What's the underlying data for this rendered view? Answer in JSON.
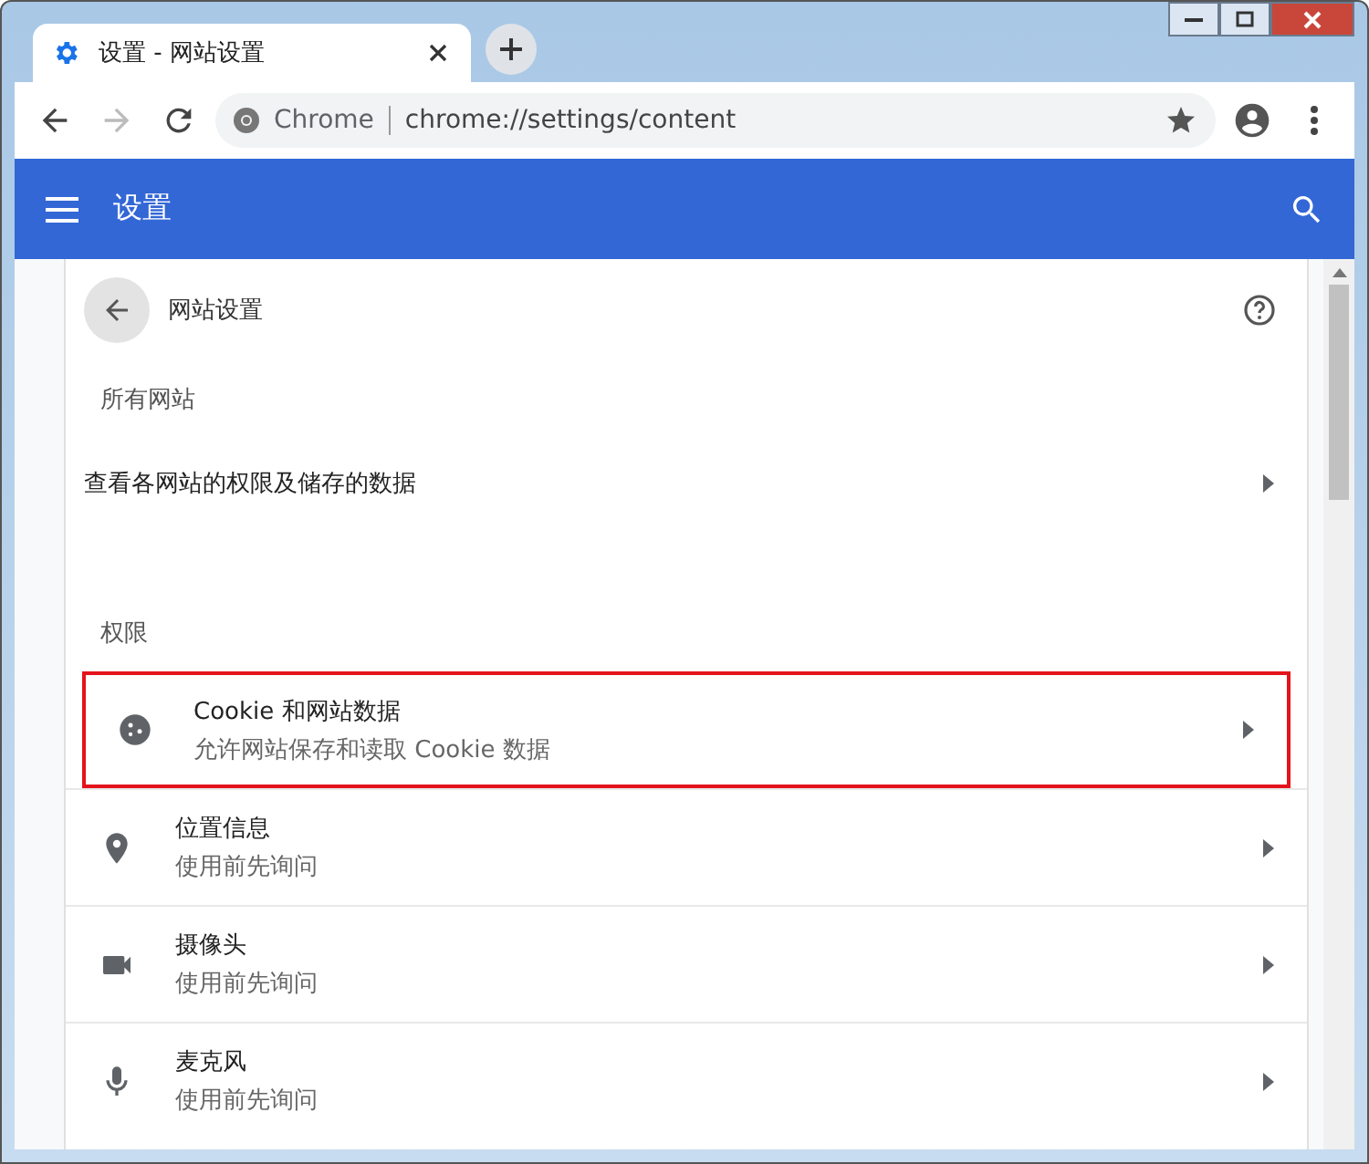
{
  "tab": {
    "title": "设置 - 网站设置"
  },
  "address": {
    "site": "Chrome",
    "url": "chrome://settings/content"
  },
  "header": {
    "title": "设置"
  },
  "page": {
    "title": "网站设置"
  },
  "sections": [
    {
      "heading": "所有网站",
      "items": [
        {
          "kind": "plain",
          "title": "查看各网站的权限及储存的数据",
          "highlighted": false
        }
      ]
    },
    {
      "heading": "权限",
      "items": [
        {
          "kind": "cookie",
          "title": "Cookie 和网站数据",
          "subtitle": "允许网站保存和读取 Cookie 数据",
          "highlighted": true
        },
        {
          "kind": "location",
          "title": "位置信息",
          "subtitle": "使用前先询问",
          "highlighted": false
        },
        {
          "kind": "camera",
          "title": "摄像头",
          "subtitle": "使用前先询问",
          "highlighted": false
        },
        {
          "kind": "mic",
          "title": "麦克风",
          "subtitle": "使用前先询问",
          "highlighted": false
        }
      ]
    }
  ]
}
